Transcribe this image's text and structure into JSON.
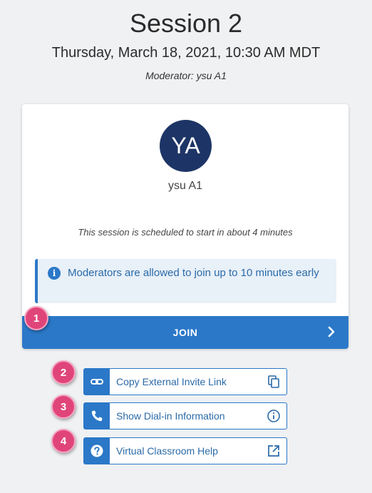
{
  "header": {
    "title": "Session 2",
    "datetime": "Thursday, March 18, 2021, 10:30 AM MDT",
    "moderator": "Moderator: ysu A1"
  },
  "card": {
    "avatar_initials": "YA",
    "avatar_name": "ysu A1",
    "schedule_text": "This session is scheduled to start in about 4 minutes",
    "info_text": "Moderators are allowed to join up to 10 minutes early",
    "join_label": "JOIN"
  },
  "actions": [
    {
      "label": "Copy External Invite Link",
      "badge": "2"
    },
    {
      "label": "Show Dial-in Information",
      "badge": "3"
    },
    {
      "label": "Virtual Classroom Help",
      "badge": "4"
    }
  ],
  "join_badge": "1",
  "colors": {
    "primary": "#2b78c8",
    "avatar": "#1d3566",
    "badge": "#e0457a",
    "background": "#f0f1f3"
  },
  "icons": [
    "info-icon",
    "chevron-right-icon",
    "link-icon",
    "copy-icon",
    "phone-icon",
    "info-circle-icon",
    "help-icon",
    "external-link-icon"
  ]
}
